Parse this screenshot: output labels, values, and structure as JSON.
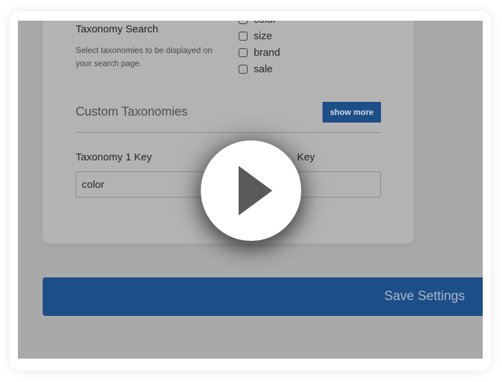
{
  "taxonomy_search": {
    "title": "Taxonomy Search",
    "description": "Select taxonomies to be displayed on your search page.",
    "options": [
      "color",
      "size",
      "brand",
      "sale"
    ]
  },
  "custom_taxonomies": {
    "title": "Custom Taxonomies",
    "show_more_label": "show more",
    "key1_label": "Taxonomy 1 Key",
    "key1_value": "color",
    "key2_label_visible": "Key",
    "key2_value": ""
  },
  "save_button_label": "Save Settings",
  "overlay": {
    "icon": "play-icon"
  },
  "colors": {
    "accent": "#1d4e87",
    "overlay_bg": "#a9a9a9",
    "play_circle": "#ffffff"
  }
}
